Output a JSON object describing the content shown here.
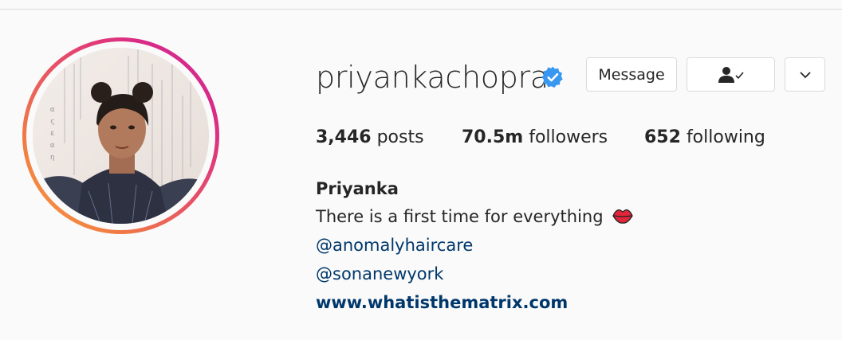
{
  "profile": {
    "username": "priyankachopra",
    "full_name": "Priyanka",
    "verified_icon": "verified-badge-icon",
    "avatar": "profile-photo"
  },
  "actions": {
    "message_label": "Message",
    "following_icon": "person-check-icon",
    "more_icon": "chevron-down-icon"
  },
  "stats": {
    "posts_count": "3,446",
    "posts_label": "posts",
    "followers_count": "70.5m",
    "followers_label": "followers",
    "following_count": "652",
    "following_label": "following"
  },
  "bio": {
    "text": "There is a first time for everything",
    "emoji_icon": "kiss-lips-icon",
    "mention_1": "@anomalyhaircare",
    "mention_2": "@sonanewyork",
    "website": "www.whatisthematrix.com"
  },
  "colors": {
    "link": "#00376b",
    "verified": "#3897f0",
    "ring_start": "#f9a13c",
    "ring_end": "#c72f9c"
  }
}
